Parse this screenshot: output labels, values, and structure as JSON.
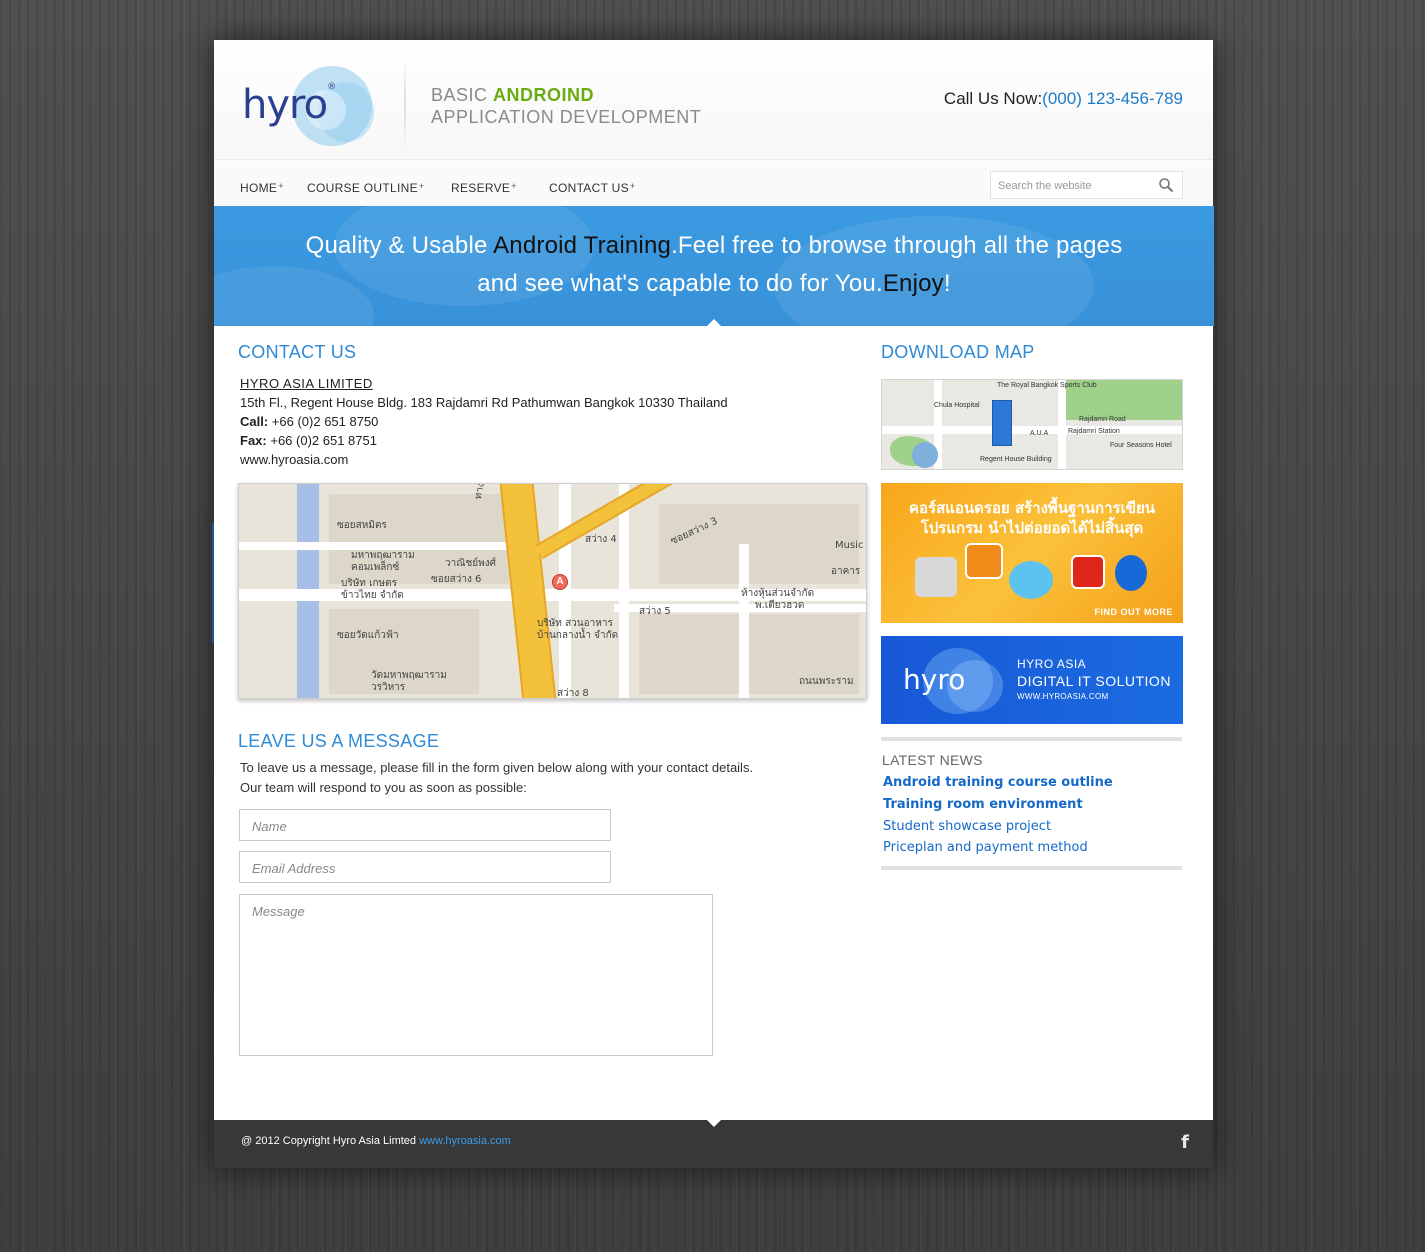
{
  "header": {
    "logo_text": "hyro",
    "logo_reg": "®",
    "tagline_prefix": "BASIC ",
    "tagline_highlight": "ANDROIND",
    "tagline_line2": "APPLICATION DEVELOPMENT",
    "call_label": "Call Us Now:",
    "call_number": "(000) 123-456-789"
  },
  "nav": {
    "items": [
      {
        "label": "HOME",
        "plus": "+"
      },
      {
        "label": "COURSE OUTLINE",
        "plus": "+"
      },
      {
        "label": "RESERVE",
        "plus": "+"
      },
      {
        "label": "CONTACT US",
        "plus": "+"
      }
    ],
    "search_placeholder": "Search the website"
  },
  "banner": {
    "l1_a": "Quality & Usable ",
    "l1_b": "Android Training",
    "l1_c": ".Feel free to browse through all the pages",
    "l2_a": "and see what's capable to do for You.",
    "l2_b": "Enjoy",
    "l2_c": "!"
  },
  "contact": {
    "title": "CONTACT US",
    "company": "HYRO ASIA LIMITED",
    "address": "15th Fl., Regent House Bldg. 183 Rajdamri Rd  Pathumwan Bangkok 10330 Thailand",
    "call_label": "Call:",
    "call_value": "+66 (0)2 651 8750",
    "fax_label": "Fax:",
    "fax_value": "+66 (0)2 651 8751",
    "website": "www.hyroasia.com"
  },
  "map": {
    "pin_label": "A",
    "labels": [
      "ซอยสหมิตร",
      "มหาพฤฒาราม",
      "คอมเพล็กซ์",
      "วาณิชย์พงศ์",
      "ซอยสว่าง 6",
      "บริษัท เกษตร",
      "ข้าวไทย จำกัด",
      "ซอยวัดแก้วฟ้า",
      "วัดมหาพฤฒาราม",
      "วรวิหาร",
      "สว่าง 4",
      "ซอยสว่าง 3",
      "สว่าง 5",
      "ห้างหุ้นส่วนจำกัด",
      "พ.เตียวฮวด",
      "บริษัท สวนอาหาร",
      "บ้านกลางน้ำ จำกัด",
      "Music",
      "อาคาร",
      "ถนนพระราม",
      "ทางพิเศษศรีรัช",
      "สว่าง 8"
    ]
  },
  "message": {
    "title": "LEAVE US A MESSAGE",
    "intro_line1": "To leave us a message, please fill in the form given below along with your contact details.",
    "intro_line2": "Our team will respond to you as soon as possible:",
    "name_placeholder": "Name",
    "email_placeholder": "Email Address",
    "message_placeholder": "Message"
  },
  "sidebar": {
    "download_title": "DOWNLOAD MAP",
    "map_labels": [
      "The Royal Bangkok Sports Club",
      "Chula Hospital",
      "Rajdamri Road",
      "A.U.A",
      "Rajdamri Station",
      "Four Seasons Hotel",
      "Regent House Building"
    ],
    "promo_line1": "คอร์สแอนดรอย สร้างพื้นฐานการเขียน",
    "promo_line2": "โปรแกรม นำไปต่อยอดได้ไม่สิ้นสุด",
    "promo_more": "FIND OUT MORE",
    "ad_logo": "hyro",
    "ad_line1": "HYRO ASIA",
    "ad_line2": "DIGITAL IT SOLUTION",
    "ad_line3": "WWW.HYROASIA.COM",
    "news_title": "LATEST NEWS",
    "news": [
      "Android training course outline",
      "Training room environment",
      "Student showcase project",
      "Priceplan and payment method"
    ]
  },
  "footer": {
    "copyright": "@ 2012 Copyright Hyro Asia Limted ",
    "link": "www.hyroasia.com",
    "facebook": "f"
  }
}
